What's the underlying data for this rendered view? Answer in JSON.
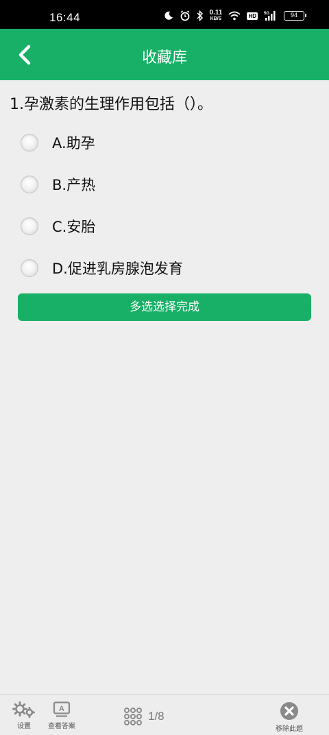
{
  "status_bar": {
    "time": "16:44",
    "net_speed_value": "0.11",
    "net_speed_unit": "KB/S",
    "hd_badge": "HD",
    "signal_label": "5G",
    "battery": "94"
  },
  "header": {
    "title": "收藏库",
    "background_color": "#17b066"
  },
  "question": {
    "text": "1.孕激素的生理作用包括（）。",
    "options": [
      {
        "label": "A.助孕"
      },
      {
        "label": "B.产热"
      },
      {
        "label": "C.安胎"
      },
      {
        "label": "D.促进乳房腺泡发育"
      }
    ],
    "submit_label": "多选选择完成"
  },
  "bottom_bar": {
    "settings_label": "设置",
    "answer_label": "查看答案",
    "answer_icon_letter": "A",
    "progress": "1/8",
    "remove_label": "移除此题"
  }
}
